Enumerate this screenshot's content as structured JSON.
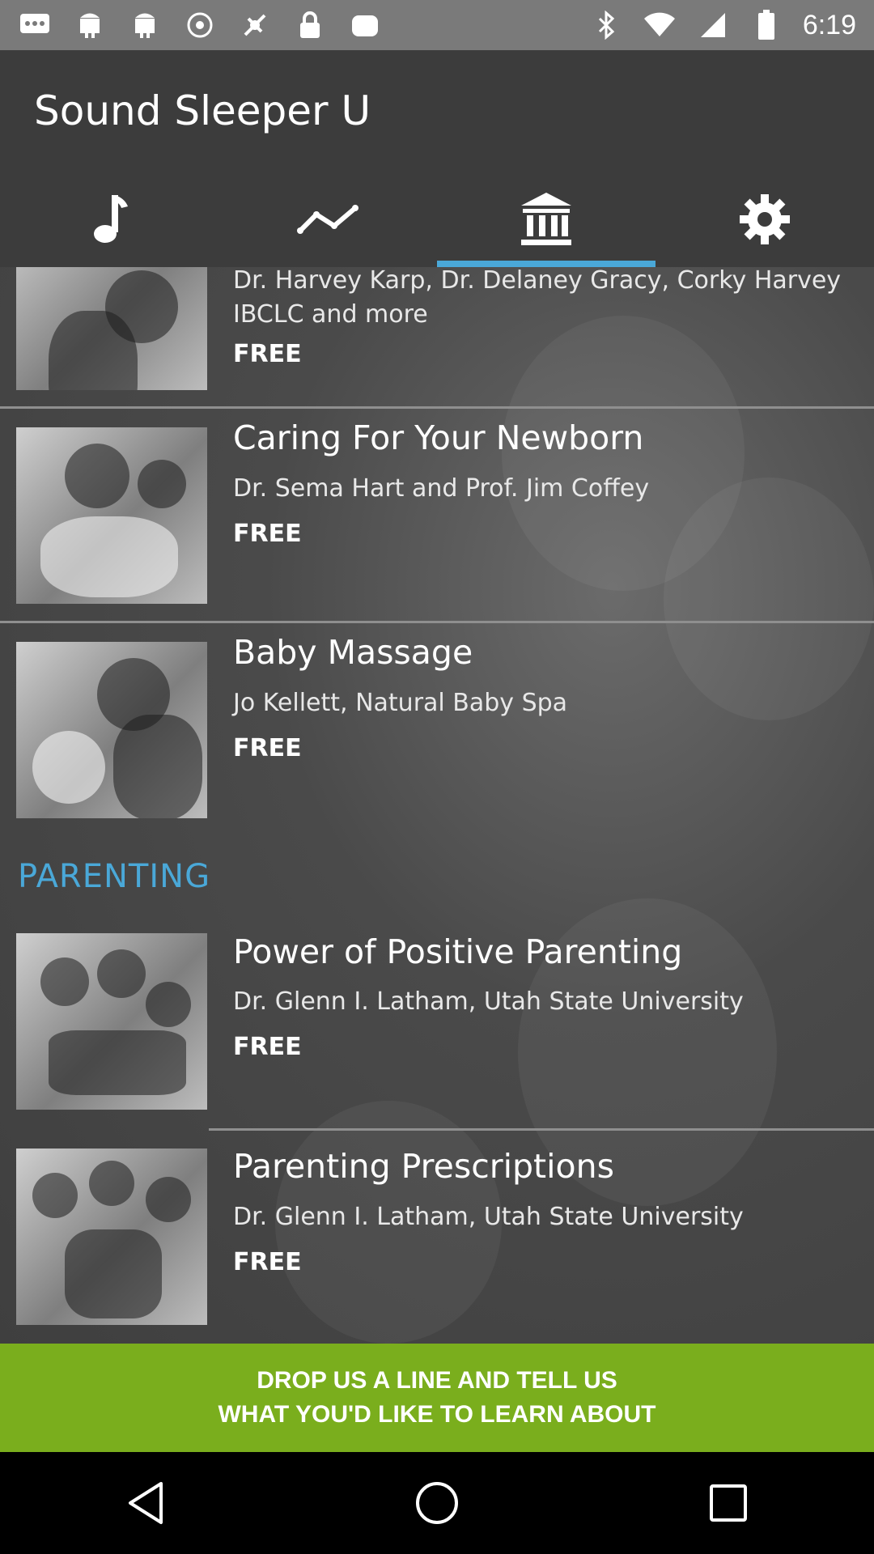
{
  "status_bar": {
    "time": "6:19",
    "left_icons": [
      "message-icon",
      "android-icon",
      "android-icon",
      "cast-icon",
      "no-sim-icon",
      "lock-icon",
      "app-icon"
    ],
    "right_icons": [
      "bluetooth-icon",
      "wifi-icon",
      "signal-icon",
      "battery-icon"
    ]
  },
  "header": {
    "title": "Sound Sleeper U",
    "tabs": [
      {
        "icon": "music-note-icon",
        "active": false
      },
      {
        "icon": "trend-line-icon",
        "active": false
      },
      {
        "icon": "library-icon",
        "active": true
      },
      {
        "icon": "gear-icon",
        "active": false
      }
    ]
  },
  "courses": [
    {
      "title": "",
      "subtitle": "Dr. Harvey Karp, Dr. Delaney Gracy, Corky Harvey IBCLC and more",
      "price": "FREE"
    },
    {
      "title": "Caring For Your Newborn",
      "subtitle": "Dr. Sema Hart and Prof. Jim Coffey",
      "price": "FREE"
    },
    {
      "title": "Baby Massage",
      "subtitle": "Jo Kellett, Natural Baby Spa",
      "price": "FREE"
    }
  ],
  "parenting": {
    "heading": "PARENTING",
    "courses": [
      {
        "title": "Power of Positive Parenting",
        "subtitle": "Dr. Glenn I. Latham, Utah State University",
        "price": "FREE"
      },
      {
        "title": "Parenting Prescriptions",
        "subtitle": "Dr. Glenn I. Latham, Utah State University",
        "price": "FREE"
      }
    ]
  },
  "cta": {
    "line1": "DROP US A LINE AND TELL US",
    "line2": "WHAT YOU'D LIKE TO LEARN ABOUT"
  },
  "colors": {
    "accent": "#4aa8d8",
    "cta": "#7aae1d",
    "header": "#3c3c3c"
  }
}
